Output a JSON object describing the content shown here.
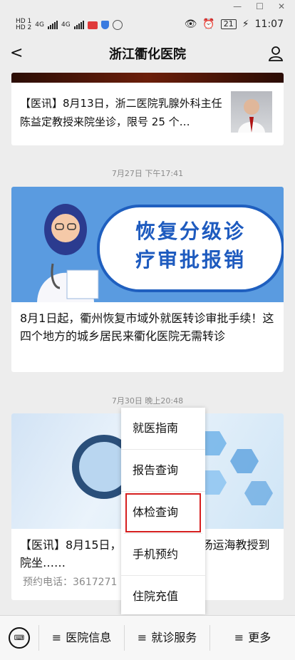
{
  "window": {
    "minimize": "—",
    "restore": "☐",
    "close": "✕"
  },
  "status": {
    "hd1": "HD 1",
    "hd2": "HD 2",
    "net1": "4G",
    "net2": "4G",
    "battery": "21",
    "time": "11:07"
  },
  "header": {
    "title": "浙江衢化医院",
    "back": "<"
  },
  "card1": {
    "text": "【医讯】8月13日，浙二医院乳腺外科主任陈益定教授来院坐诊，限号 25 个…"
  },
  "time1": "7月27日 下午17:41",
  "card2": {
    "banner_line1": "恢复分级诊",
    "banner_line2": "疗审批报销",
    "text": "8月1日起，衢州恢复市域外就医转诊审批手续！这四个地方的城乡居民来衢化医院无需转诊"
  },
  "time2": "7月30日 晚上20:48",
  "card3": {
    "text": "【医讯】8月15日，……胸外科专家杨运海教授到院坐……",
    "sub": "预约电话：3617271"
  },
  "menu": {
    "items": [
      "就医指南",
      "报告查询",
      "体检查询",
      "手机预约",
      "住院充值"
    ]
  },
  "tabbar": {
    "items": [
      "医院信息",
      "就诊服务",
      "更多"
    ],
    "ham": "≡"
  },
  "colors": {
    "accent_red": "#d61f1f",
    "banner_blue": "#5a9be0"
  }
}
